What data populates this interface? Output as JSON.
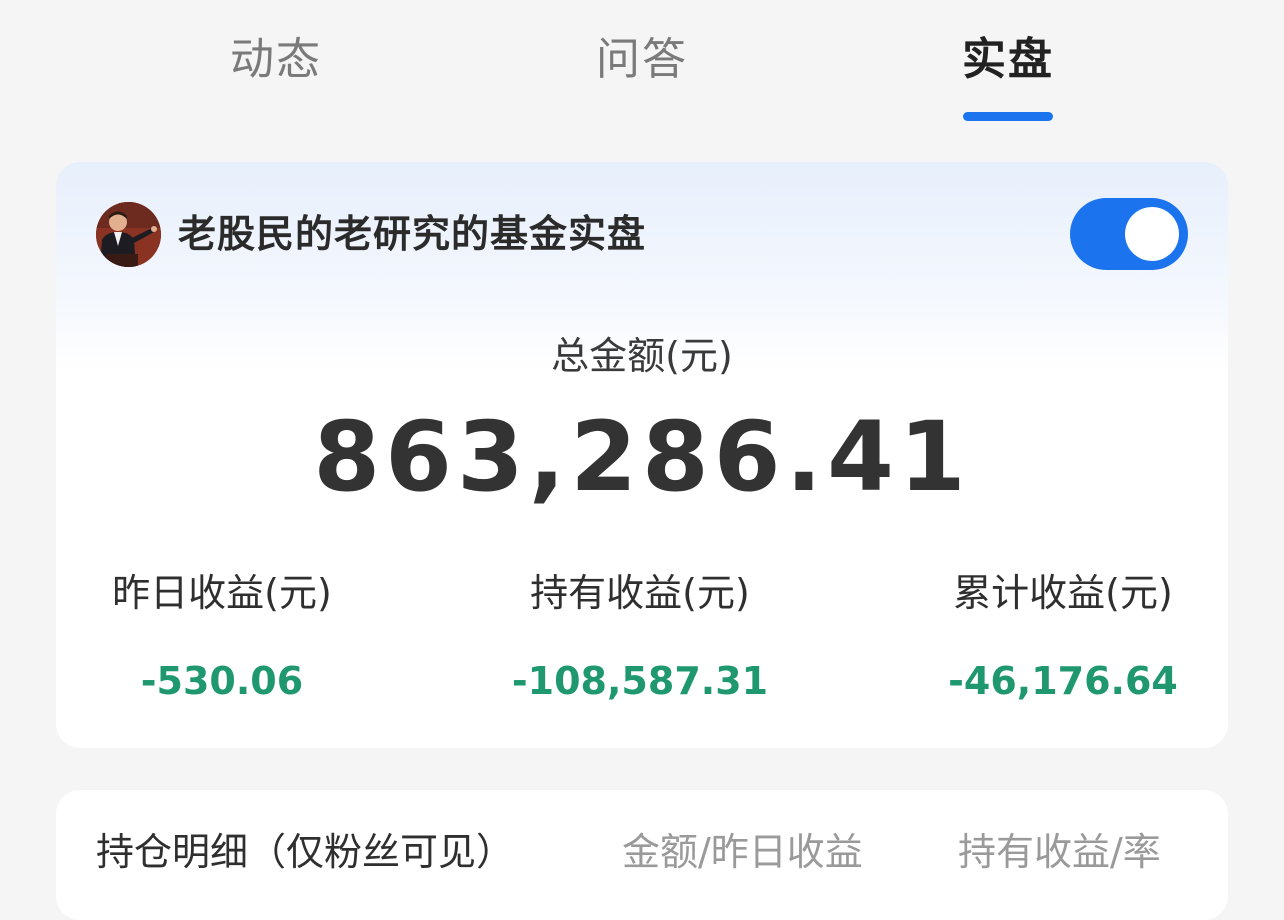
{
  "tabs": [
    {
      "label": "动态",
      "active": false
    },
    {
      "label": "问答",
      "active": false
    },
    {
      "label": "实盘",
      "active": true
    }
  ],
  "colors": {
    "accent": "#1b74ee",
    "negative": "#1f9870",
    "background": "#f5f5f5"
  },
  "account": {
    "name": "老股民的老研究的基金实盘",
    "toggle_on": true
  },
  "summary": {
    "total_label": "总金额(元)",
    "total_value": "863,286.41",
    "stats": [
      {
        "label": "昨日收益(元)",
        "value": "-530.06"
      },
      {
        "label": "持有收益(元)",
        "value": "-108,587.31"
      },
      {
        "label": "累计收益(元)",
        "value": "-46,176.64"
      }
    ]
  },
  "holdings": {
    "title": "持仓明细（仅粉丝可见）",
    "col1": "金额/昨日收益",
    "col2": "持有收益/率"
  }
}
